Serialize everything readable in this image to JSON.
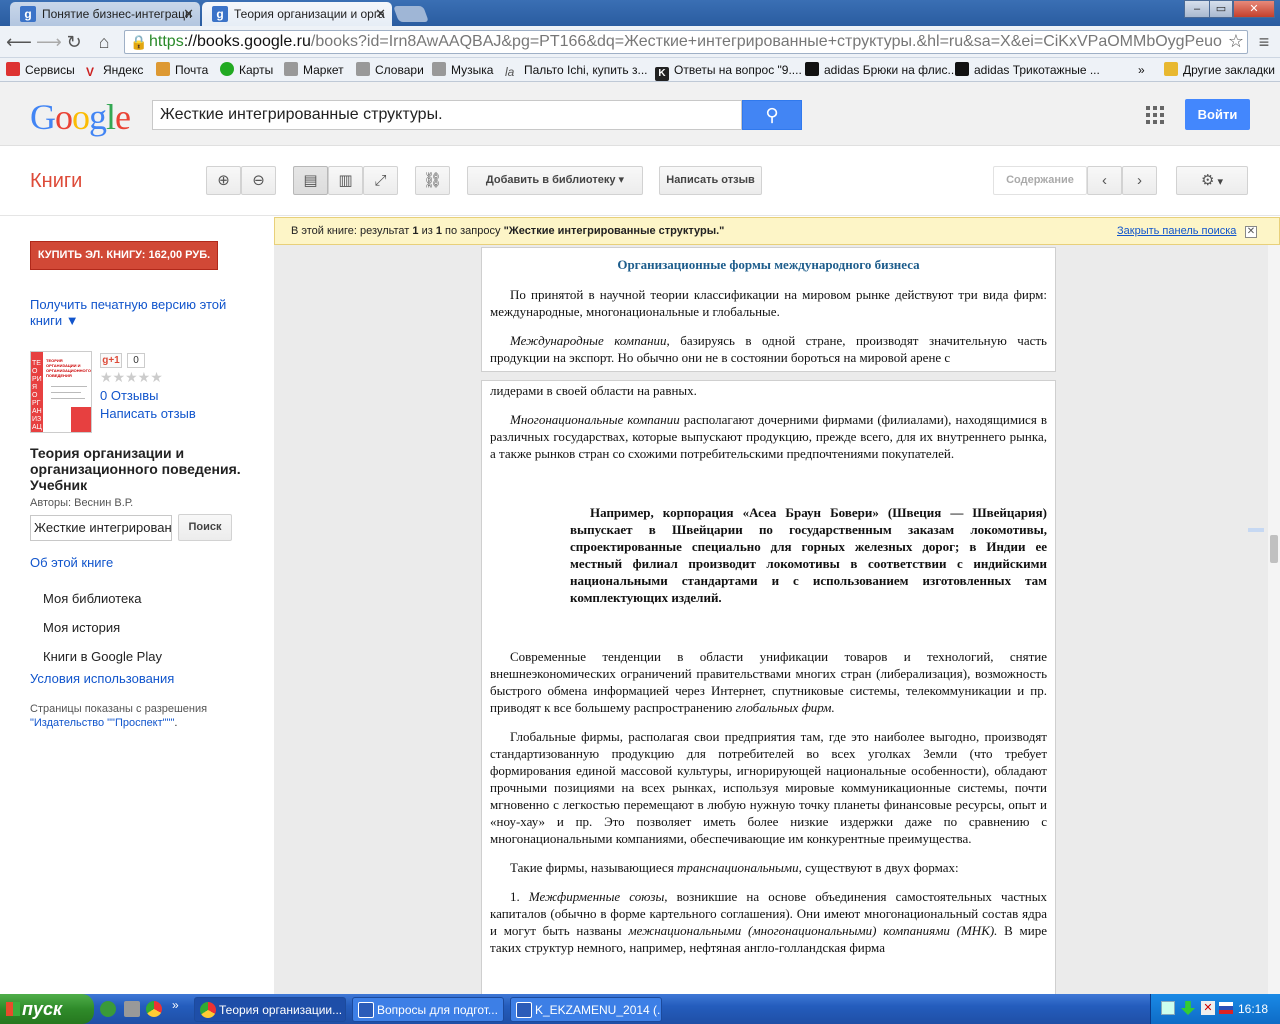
{
  "browser": {
    "tabs": [
      {
        "title": "Понятие бизнес-интеграци",
        "favicon": "g",
        "active": false
      },
      {
        "title": "Теория организации и орга",
        "favicon": "g",
        "active": true
      }
    ],
    "url_scheme": "https",
    "url_host": "://books.google.ru",
    "url_rest": "/books?id=Irn8AwAAQBAJ&pg=PT166&dq=Жесткие+интегрированные+структуры.&hl=ru&sa=X&ei=CiKxVPaOMMbOygPeuo",
    "window_buttons": [
      "–",
      "▭",
      "✕"
    ]
  },
  "bookmarks": [
    {
      "label": "Сервисы",
      "icon": "apps-icon",
      "color": "#d33"
    },
    {
      "label": "Яндекс",
      "icon": "yandex-icon",
      "color": "#c22"
    },
    {
      "label": "Почта",
      "icon": "mail-icon",
      "color": "#d93"
    },
    {
      "label": "Карты",
      "icon": "maps-icon",
      "color": "#2a2"
    },
    {
      "label": "Маркет",
      "icon": "market-icon",
      "color": "#777"
    },
    {
      "label": "Словари",
      "icon": "dictionary-icon",
      "color": "#777"
    },
    {
      "label": "Музыка",
      "icon": "music-icon",
      "color": "#777"
    },
    {
      "label": "Пальто Ichi, купить з...",
      "icon": "lamoda-icon",
      "color": "#777"
    },
    {
      "label": "Ответы на вопрос \"9....",
      "icon": "answers-icon",
      "color": "#222"
    },
    {
      "label": "adidas Брюки на флис...",
      "icon": "adidas-icon",
      "color": "#111"
    },
    {
      "label": "adidas Трикотажные ...",
      "icon": "adidas-icon",
      "color": "#111"
    },
    {
      "label": "»",
      "icon": "",
      "color": ""
    },
    {
      "label": "Другие закладки",
      "icon": "folder-icon",
      "color": "#e8b830"
    }
  ],
  "google": {
    "logo": "Google",
    "search_value": "Жесткие интегрированные структуры.",
    "signin": "Войти"
  },
  "books_toolbar": {
    "section": "Книги",
    "add_library": "Добавить в библиотеку",
    "write_review": "Написать отзыв",
    "contents": "Содержание"
  },
  "sidebar": {
    "buy": "КУПИТЬ ЭЛ. КНИГУ: 162,00 РУБ.",
    "print_version": "Получить печатную версию этой",
    "print_version_2": "книги ▼",
    "gplus": "g+1",
    "gplus_count": "0",
    "stars": "★★★★★",
    "reviews": "0 Отзывы",
    "write_review": "Написать отзыв",
    "book_title": "Теория организации и организационного поведения. Учебник",
    "authors": "Авторы: Веснин В.Р.",
    "in_book_search": "Жесткие интегрированн",
    "search_btn": "Поиск",
    "about": "Об этой книге",
    "my_library": "Моя библиотека",
    "my_history": "Моя история",
    "play_books": "Книги в Google Play",
    "terms": "Условия использования",
    "permission": "Страницы показаны с разрешения",
    "publisher": "\"Издательство \"\"Проспект\"\"\"",
    "publisher_dot": "."
  },
  "notice": {
    "pre": "В этой книге: результат ",
    "n1": "1",
    "mid": " из ",
    "n2": "1",
    "post": " по запросу ",
    "query": "\"Жесткие интегрированные структуры.\"",
    "close": "Закрыть панель поиска"
  },
  "book_page": {
    "heading": "Организационные формы международного бизнеса",
    "p1": "По принятой в научной теории классификации на мировом рынке действуют три вида фирм: международные, многонациональные и глобальные.",
    "p2_em": "Международные компании,",
    "p2": " базируясь в одной стране, производят значительную часть продукции на экспорт. Но обычно они не в состоянии бороться на мировой арене с",
    "p3": "лидерами в своей области на равных.",
    "p4_em": "Многонациональные компании",
    "p4": " располагают дочерними фирмами (филиалами), находящимися в различных государствах, которые выпускают продукцию, прежде всего, для их внутреннего рынка, а также рынков стран со схожими потребительскими предпочтениями покупателей.",
    "example": "Например, корпорация «Асеа Браун Бовери» (Швеция — Швейцария) выпускает в Швейцарии по государственным заказам локомотивы, спроектированные специально для горных железных дорог; в Индии ее местный филиал производит локомотивы в соответствии с индийскими национальными стандартами и с использованием изготовленных там комплектующих изделий.",
    "p5": "Современные тенденции в области унификации товаров и технологий, снятие внешнеэкономических ограничений правительствами многих стран (либерализация), возможность быстрого обмена информацией через Интернет, спутниковые системы, телекоммуникации и пр. приводят к все большему распространению ",
    "p5_em": "глобальных фирм.",
    "p6": "Глобальные фирмы, располагая свои предприятия там, где это наиболее выгодно, производят стандартизованную продукцию для потребителей во всех уголках Земли (что требует формирования единой массовой культуры, игнорирующей национальные особенности), обладают прочными позициями на всех рынках, используя мировые коммуникационные системы, почти мгновенно с легкостью перемещают в любую нужную точку планеты финансовые ресурсы, опыт и «ноу-хау» и пр. Это позволяет иметь более низкие издержки даже по сравнению с многонациональными компаниями, обеспечивающие им конкурентные преимущества.",
    "p7": "Такие фирмы, называющиеся ",
    "p7_em": "транснациональными,",
    "p7_end": " существуют в двух формах:",
    "p8_num": "1. ",
    "p8_em": "Межфирменные союзы,",
    "p8": " возникшие на основе объединения самостоятельных частных капиталов (обычно в форме картельного соглашения). Они имеют многонациональный состав ядра и могут быть названы ",
    "p8_em2": "межнациональными (многонациональными) компаниями (МНК).",
    "p8_end": " В мире таких структур немного, например, нефтяная англо-голландская фирма"
  },
  "taskbar": {
    "start": "пуск",
    "tasks": [
      {
        "label": "Теория организации...",
        "icon": "chrome-icon",
        "active": true
      },
      {
        "label": "Вопросы для подгот...",
        "icon": "word-icon",
        "active": false
      },
      {
        "label": "K_EKZAMENU_2014 (...",
        "icon": "word-icon",
        "active": false
      }
    ],
    "clock": "16:18"
  }
}
